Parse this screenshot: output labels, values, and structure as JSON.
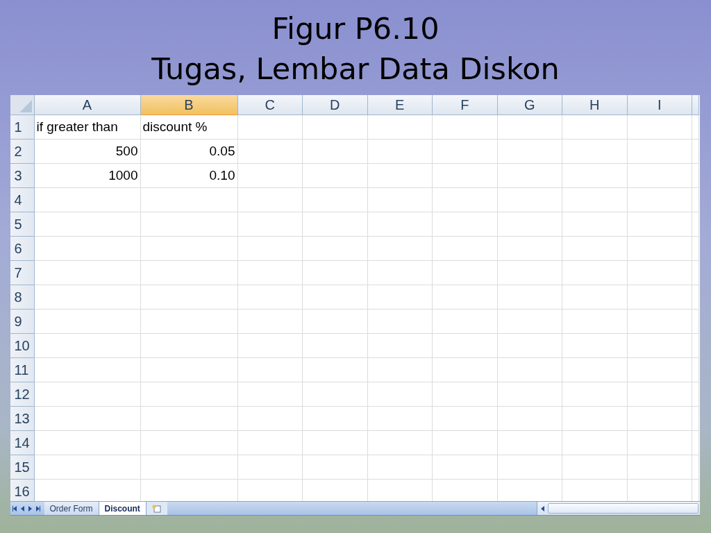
{
  "slide": {
    "title_lines": [
      "Figur P6.10",
      "Tugas, Lembar Data Diskon"
    ]
  },
  "spreadsheet": {
    "columns": [
      {
        "label": "A",
        "selected": false
      },
      {
        "label": "B",
        "selected": true
      },
      {
        "label": "C",
        "selected": false
      },
      {
        "label": "D",
        "selected": false
      },
      {
        "label": "E",
        "selected": false
      },
      {
        "label": "F",
        "selected": false
      },
      {
        "label": "G",
        "selected": false
      },
      {
        "label": "H",
        "selected": false
      },
      {
        "label": "I",
        "selected": false
      }
    ],
    "rows": [
      {
        "number": "1",
        "cells": [
          {
            "value": "if greater than",
            "kind": "text"
          },
          {
            "value": "discount %",
            "kind": "text"
          }
        ]
      },
      {
        "number": "2",
        "cells": [
          {
            "value": "500",
            "kind": "number"
          },
          {
            "value": "0.05",
            "kind": "number"
          }
        ]
      },
      {
        "number": "3",
        "cells": [
          {
            "value": "1000",
            "kind": "number"
          },
          {
            "value": "0.10",
            "kind": "number"
          }
        ]
      },
      {
        "number": "4",
        "cells": []
      },
      {
        "number": "5",
        "cells": []
      },
      {
        "number": "6",
        "cells": []
      },
      {
        "number": "7",
        "cells": []
      },
      {
        "number": "8",
        "cells": []
      },
      {
        "number": "9",
        "cells": []
      },
      {
        "number": "10",
        "cells": []
      },
      {
        "number": "11",
        "cells": []
      },
      {
        "number": "12",
        "cells": []
      },
      {
        "number": "13",
        "cells": []
      },
      {
        "number": "14",
        "cells": []
      },
      {
        "number": "15",
        "cells": []
      },
      {
        "number": "16",
        "cells": []
      }
    ],
    "sheet_tabs": [
      {
        "label": "Order Form",
        "selected": false
      },
      {
        "label": "Discount",
        "selected": true
      }
    ]
  }
}
